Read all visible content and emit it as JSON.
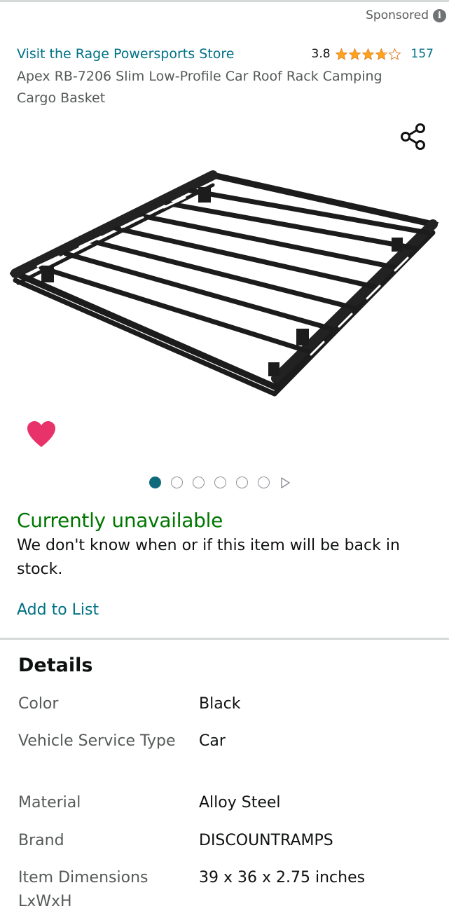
{
  "sponsored": {
    "label": "Sponsored"
  },
  "store": {
    "link_text": "Visit the Rage Powersports Store"
  },
  "rating": {
    "value": "3.8",
    "stars_filled": 3.8,
    "stars_total": 5,
    "count": "157",
    "star_color": "#ffa41c"
  },
  "product": {
    "title": "Apex RB-7206 Slim Low-Profile Car Roof Rack Camping Cargo Basket"
  },
  "gallery": {
    "image_count": 6,
    "active_index": 0
  },
  "colors": {
    "link": "#007185",
    "availability": "#007600",
    "heart": "#e8336a",
    "dot_active": "#0e6a7a"
  },
  "availability": {
    "status": "Currently unavailable",
    "note": "We don't know when or if this item will be back in stock."
  },
  "actions": {
    "add_to_list": "Add to List"
  },
  "details": {
    "heading": "Details",
    "rows": [
      {
        "key": "Color",
        "value": "Black"
      },
      {
        "key": "Vehicle Service Type",
        "value": "Car"
      },
      {
        "key": "Material",
        "value": "Alloy Steel"
      },
      {
        "key": "Brand",
        "value": "DISCOUNTRAMPS"
      },
      {
        "key": "Item Dimensions LxWxH",
        "value": "39 x 36 x 2.75 inches"
      }
    ]
  }
}
